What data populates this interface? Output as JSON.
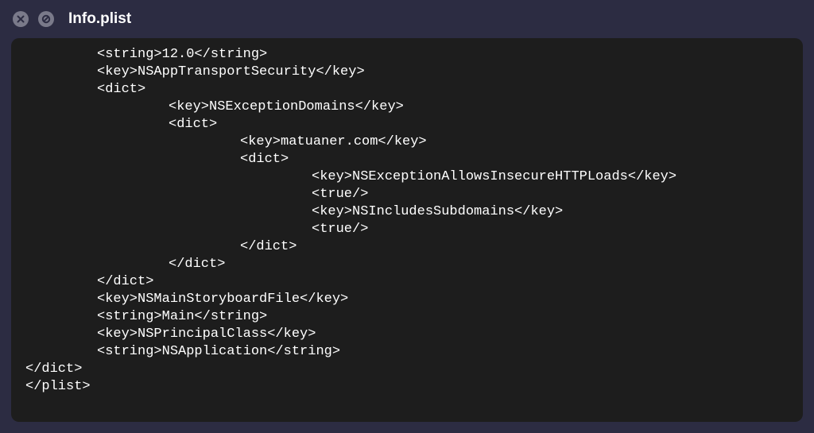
{
  "tab": {
    "title": "Info.plist"
  },
  "code": {
    "l1": "<string>12.0</string>",
    "l2": "<key>NSAppTransportSecurity</key>",
    "l3": "<dict>",
    "l4": "<key>NSExceptionDomains</key>",
    "l5": "<dict>",
    "l6": "<key>matuaner.com</key>",
    "l7": "<dict>",
    "l8": "<key>NSExceptionAllowsInsecureHTTPLoads</key>",
    "l9": "<true/>",
    "l10": "<key>NSIncludesSubdomains</key>",
    "l11": "<true/>",
    "l12": "</dict>",
    "l13": "</dict>",
    "l14": "</dict>",
    "l15": "<key>NSMainStoryboardFile</key>",
    "l16": "<string>Main</string>",
    "l17": "<key>NSPrincipalClass</key>",
    "l18": "<string>NSApplication</string>",
    "l19": "</dict>",
    "l20": "</plist>"
  }
}
